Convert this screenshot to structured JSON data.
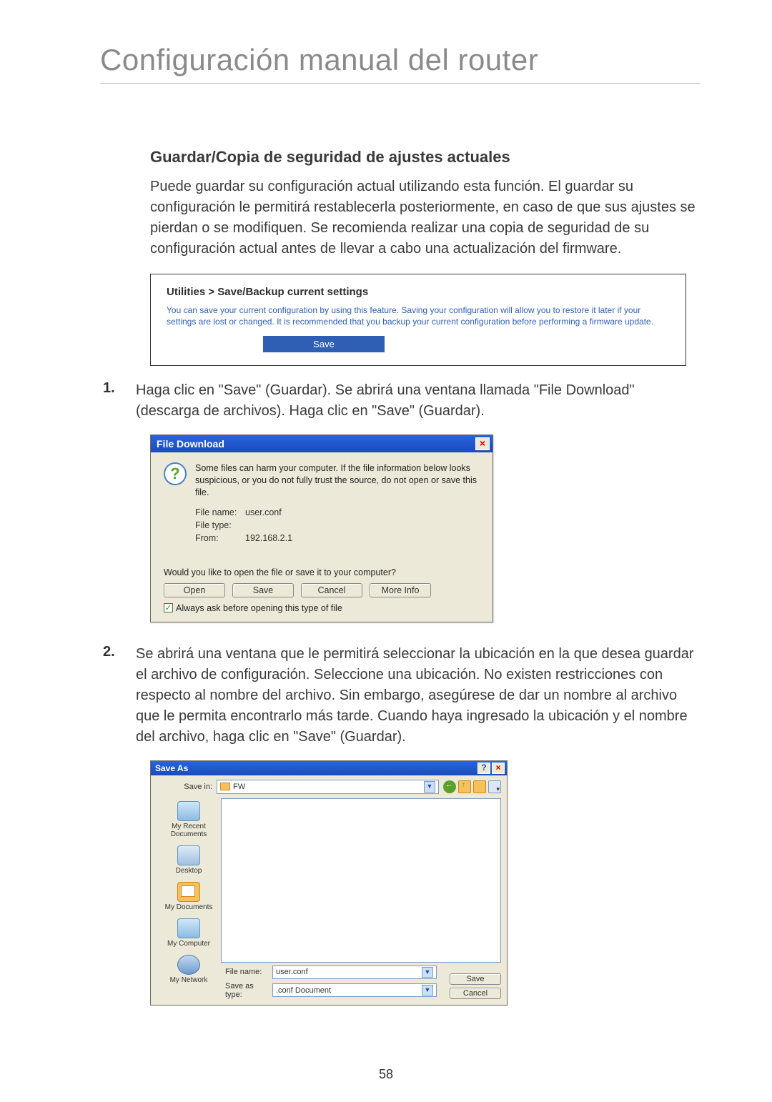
{
  "page_title": "Configuración manual del router",
  "section_heading": "Guardar/Copia de seguridad de ajustes actuales",
  "intro_paragraph": "Puede guardar su configuración actual utilizando esta función. El guardar su configuración le permitirá restablecerla posteriormente, en caso de que sus ajustes se pierdan o se modifiquen. Se recomienda realizar una copia de seguridad de su configuración actual antes de llevar a cabo una actualización del firmware.",
  "shot1": {
    "breadcrumb": "Utilities > Save/Backup current settings",
    "description": "You can save your current configuration by using this feature. Saving your configuration will allow you to restore it later if your settings are lost or changed. It is recommended that you backup your current configuration before performing a firmware update.",
    "save_label": "Save"
  },
  "step1": {
    "num": "1.",
    "text": "Haga clic en \"Save\" (Guardar). Se abrirá una ventana llamada \"File Download\" (descarga de archivos). Haga clic en \"Save\" (Guardar)."
  },
  "shot2": {
    "title": "File Download",
    "warning": "Some files can harm your computer. If the file information below looks suspicious, or you do not fully trust the source, do not open or save this file.",
    "filename_label": "File name:",
    "filename_value": "user.conf",
    "filetype_label": "File type:",
    "filetype_value": "",
    "from_label": "From:",
    "from_value": "192.168.2.1",
    "prompt": "Would you like to open the file or save it to your computer?",
    "btn_open": "Open",
    "btn_save": "Save",
    "btn_cancel": "Cancel",
    "btn_more": "More Info",
    "checkbox_label": "Always ask before opening this type of file"
  },
  "step2": {
    "num": "2.",
    "text": "Se abrirá una ventana que le permitirá seleccionar la ubicación en la que desea guardar el archivo de configuración. Seleccione una ubicación. No existen restricciones con respecto al nombre del archivo. Sin embargo, asegúrese de dar un nombre al archivo que le permita encontrarlo más tarde. Cuando haya ingresado la ubicación y el nombre del archivo, haga clic en \"Save\" (Guardar)."
  },
  "shot3": {
    "title": "Save As",
    "savein_label": "Save in:",
    "savein_value": "FW",
    "side_recent": "My Recent Documents",
    "side_desktop": "Desktop",
    "side_mydocs": "My Documents",
    "side_mycomp": "My Computer",
    "side_mynet": "My Network",
    "filename_label": "File name:",
    "filename_value": "user.conf",
    "saveas_label": "Save as type:",
    "saveas_value": ".conf Document",
    "btn_save": "Save",
    "btn_cancel": "Cancel"
  },
  "page_number": "58"
}
